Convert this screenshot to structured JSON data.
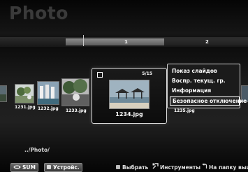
{
  "app": {
    "title": "Photo"
  },
  "timeline": {
    "segment1_label": "1",
    "segment2_label": "2"
  },
  "thumbnails": [
    {
      "name": "",
      "icon": "partial-photo-icon"
    },
    {
      "name": "1231.jpg",
      "icon": "photo-icon"
    },
    {
      "name": "1232.jpg",
      "icon": "photo-icon"
    },
    {
      "name": "1233.jpg",
      "icon": "photo-icon"
    },
    {
      "name": "1235.jpg",
      "icon": "photo-icon"
    }
  ],
  "focused": {
    "name": "1234.jpg",
    "counter": "5/15"
  },
  "tools_menu": {
    "items": [
      "Показ слайдов",
      "Воспр. текущ. гр.",
      "Информация",
      "Безопасное отключение"
    ],
    "selected_index": 3
  },
  "path": "../Photo/",
  "bottom_bar": {
    "sum_label": "SUM",
    "device_label": "Устройс.",
    "select_label": "Выбрать",
    "tools_label": "Инструменты",
    "back_label": "На папку выше"
  }
}
